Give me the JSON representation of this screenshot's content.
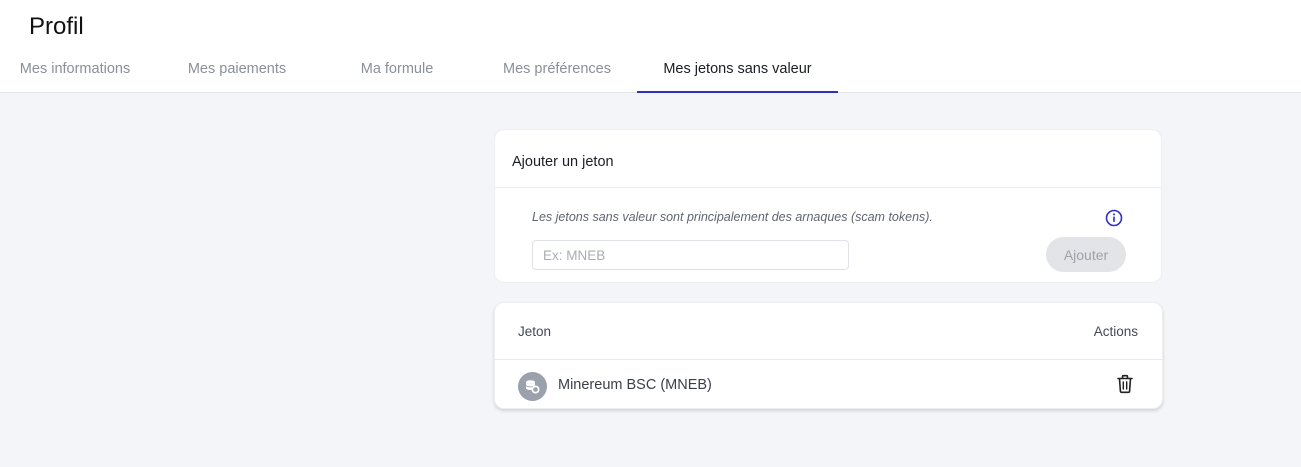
{
  "header": {
    "title": "Profil",
    "tabs": [
      {
        "label": "Mes informations"
      },
      {
        "label": "Mes paiements"
      },
      {
        "label": "Ma formule"
      },
      {
        "label": "Mes préférences"
      },
      {
        "label": "Mes jetons sans valeur",
        "active": true
      }
    ]
  },
  "add_card": {
    "title": "Ajouter un jeton",
    "info_text": "Les jetons sans valeur sont principalement des arnaques (scam tokens).",
    "info_icon": "info-icon",
    "input_placeholder": "Ex: MNEB",
    "input_value": "",
    "add_button_label": "Ajouter"
  },
  "table": {
    "columns": {
      "token": "Jeton",
      "actions": "Actions"
    },
    "rows": [
      {
        "name": "Minereum BSC (MNEB)",
        "icon": "coins-icon",
        "action_icon": "trash-icon"
      }
    ]
  },
  "colors": {
    "accent": "#2f2fc4",
    "background": "#f4f5f9",
    "disabled_button": "#e3e4e7"
  }
}
